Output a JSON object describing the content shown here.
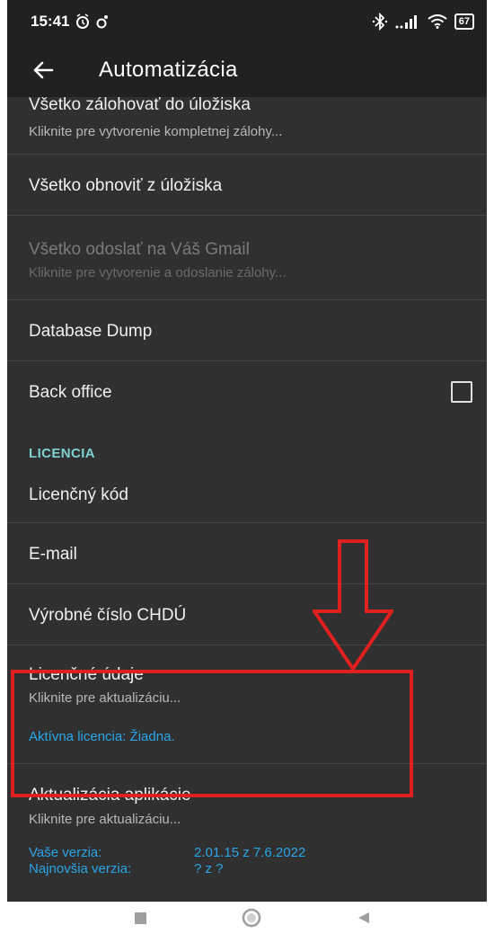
{
  "status_bar": {
    "time": "15:41",
    "icons": [
      "alarm-icon",
      "notification-icon",
      "bluetooth-icon",
      "signal-icon",
      "wifi-icon",
      "battery-icon"
    ],
    "battery_level": "67"
  },
  "app_bar": {
    "title": "Automatizácia",
    "back_icon": "arrow-back-icon"
  },
  "items": {
    "backup_all": {
      "title": "Všetko zálohovať do úložiska",
      "summary": "Kliknite pre vytvorenie kompletnej zálohy..."
    },
    "restore_all": {
      "title": "Všetko obnoviť z úložiska"
    },
    "send_gmail": {
      "title": "Všetko odoslať na Váš Gmail",
      "summary": "Kliknite pre vytvorenie a odoslanie zálohy...",
      "enabled": false
    },
    "database_dump": {
      "title": "Database Dump"
    },
    "back_office": {
      "title": "Back office",
      "checked": false
    },
    "license_code": {
      "title": "Licenčný kód"
    },
    "email": {
      "title": "E-mail"
    },
    "serial_number": {
      "title": "Výrobné číslo CHDÚ"
    },
    "license_data": {
      "title": "Licenčné údaje",
      "summary": "Kliknite pre aktualizáciu...",
      "active_license": "Aktívna licencia: Žiadna."
    },
    "app_update": {
      "title": "Aktualizácia aplikácie",
      "summary": "Kliknite pre aktualizáciu...",
      "your_version_label": "Vaše verzia:",
      "your_version_value": "2.01.15 z 7.6.2022",
      "latest_version_label": "Najnovšia verzia:",
      "latest_version_value": "? z ?"
    }
  },
  "section_license": "LICENCIA",
  "colors": {
    "background": "#303030",
    "app_bar": "#212121",
    "section_accent": "#7fd1d1",
    "link_accent": "#2aa6e8",
    "annotation_red": "#e0201f"
  },
  "nav_bar": {
    "icons": [
      "recent-apps-icon",
      "home-icon",
      "back-icon"
    ]
  }
}
